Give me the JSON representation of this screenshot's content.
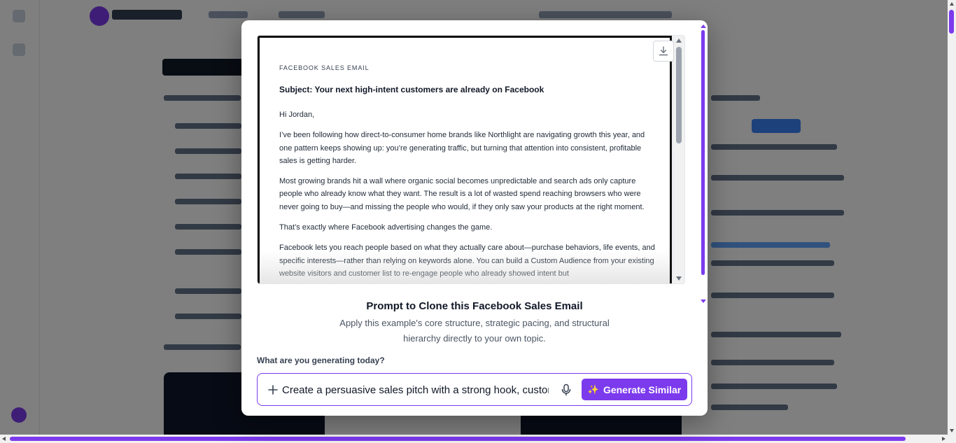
{
  "modal": {
    "preview": {
      "eyebrow": "FACEBOOK SALES EMAIL",
      "subject": "Subject: Your next high-intent customers are already on Facebook",
      "paragraphs": [
        "Hi Jordan,",
        "I’ve been following how direct-to-consumer home brands like Northlight are navigating growth this year, and one pattern keeps showing up: you’re generating traffic, but turning that attention into consistent, profitable sales is getting harder.",
        "Most growing brands hit a wall where organic social becomes unpredictable and search ads only capture people who already know what they want. The result is a lot of wasted spend reaching browsers who were never going to buy—and missing the people who would, if they only saw your products at the right moment.",
        "That’s exactly where Facebook advertising changes the game.",
        "Facebook lets you reach people based on what they actually care about—purchase behaviors, life events, and specific interests—rather than relying on keywords alone. You can build a Custom Audience from your existing website visitors and customer list to re-engage people who already showed intent but"
      ]
    },
    "clone_title": "Prompt to Clone this Facebook Sales Email",
    "clone_description": "Apply this example's core structure, strategic pacing, and structural hierarchy directly to your own topic.",
    "input_label": "What are you generating today?",
    "prompt_value": "Create a persuasive sales pitch with a strong hook, customer pain points, and a clear call to action",
    "generate_label": "Generate Similar",
    "sparkle": "✨"
  },
  "icons": {
    "download": "download-icon",
    "plus": "plus-icon",
    "mic": "microphone-icon"
  },
  "colors": {
    "accent": "#7c3aed",
    "overlay": "rgba(0,0,0,0.5)"
  }
}
